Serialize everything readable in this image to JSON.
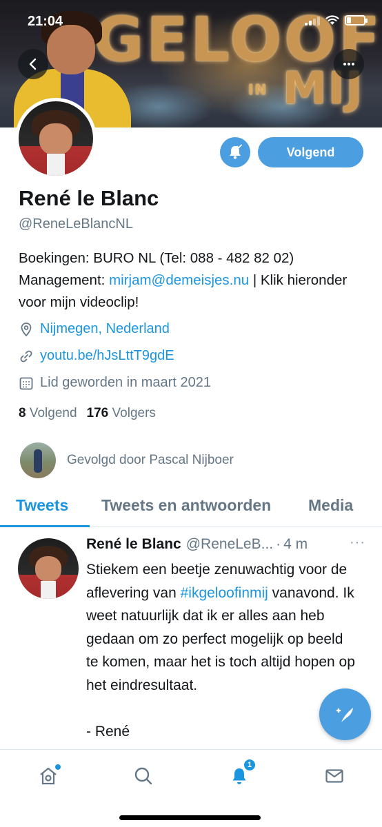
{
  "status_bar": {
    "time": "21:04"
  },
  "banner": {
    "sign_line1": "GELOOF",
    "sign_line2": "IN",
    "sign_line3": "MIJ"
  },
  "profile": {
    "name": "René le Blanc",
    "handle": "@ReneLeBlancNL",
    "follow_button": "Volgend",
    "bio_line1": "Boekingen: BURO NL (Tel: 088 - 482 82 02)",
    "bio_management_prefix": "Management: ",
    "bio_email": "mirjam@demeisjes.nu",
    "bio_suffix": " | Klik hieronder voor mijn videoclip!",
    "location": "Nijmegen, Nederland",
    "website": "youtu.be/hJsLttT9gdE",
    "joined": "Lid geworden in maart 2021",
    "following_count": "8",
    "following_label": "Volgend",
    "followers_count": "176",
    "followers_label": "Volgers",
    "followed_by": "Gevolgd door Pascal Nijboer"
  },
  "tabs": [
    {
      "label": "Tweets",
      "active": true
    },
    {
      "label": "Tweets en antwoorden",
      "active": false
    },
    {
      "label": "Media",
      "active": false
    }
  ],
  "tweet": {
    "author_name": "René le Blanc",
    "author_handle": "@ReneLeB...",
    "separator": "·",
    "time": "4 m",
    "more": "···",
    "text_before": "Stiekem een beetje zenuwachtig voor de aflevering van ",
    "hashtag": "#ikgeloofinmij",
    "text_after": " vanavond. Ik weet natuurlijk dat ik er alles aan heb gedaan om zo perfect mogelijk op beeld te komen, maar het is toch altijd hopen op het eindresultaat.",
    "signature": "- René"
  },
  "bottom_nav": {
    "notification_count": "1",
    "items": [
      "home-icon",
      "search-icon",
      "bell-icon",
      "mail-icon"
    ]
  },
  "colors": {
    "accent": "#1b95e0",
    "button_blue": "#4b9fe1",
    "secondary_text": "#657786"
  }
}
